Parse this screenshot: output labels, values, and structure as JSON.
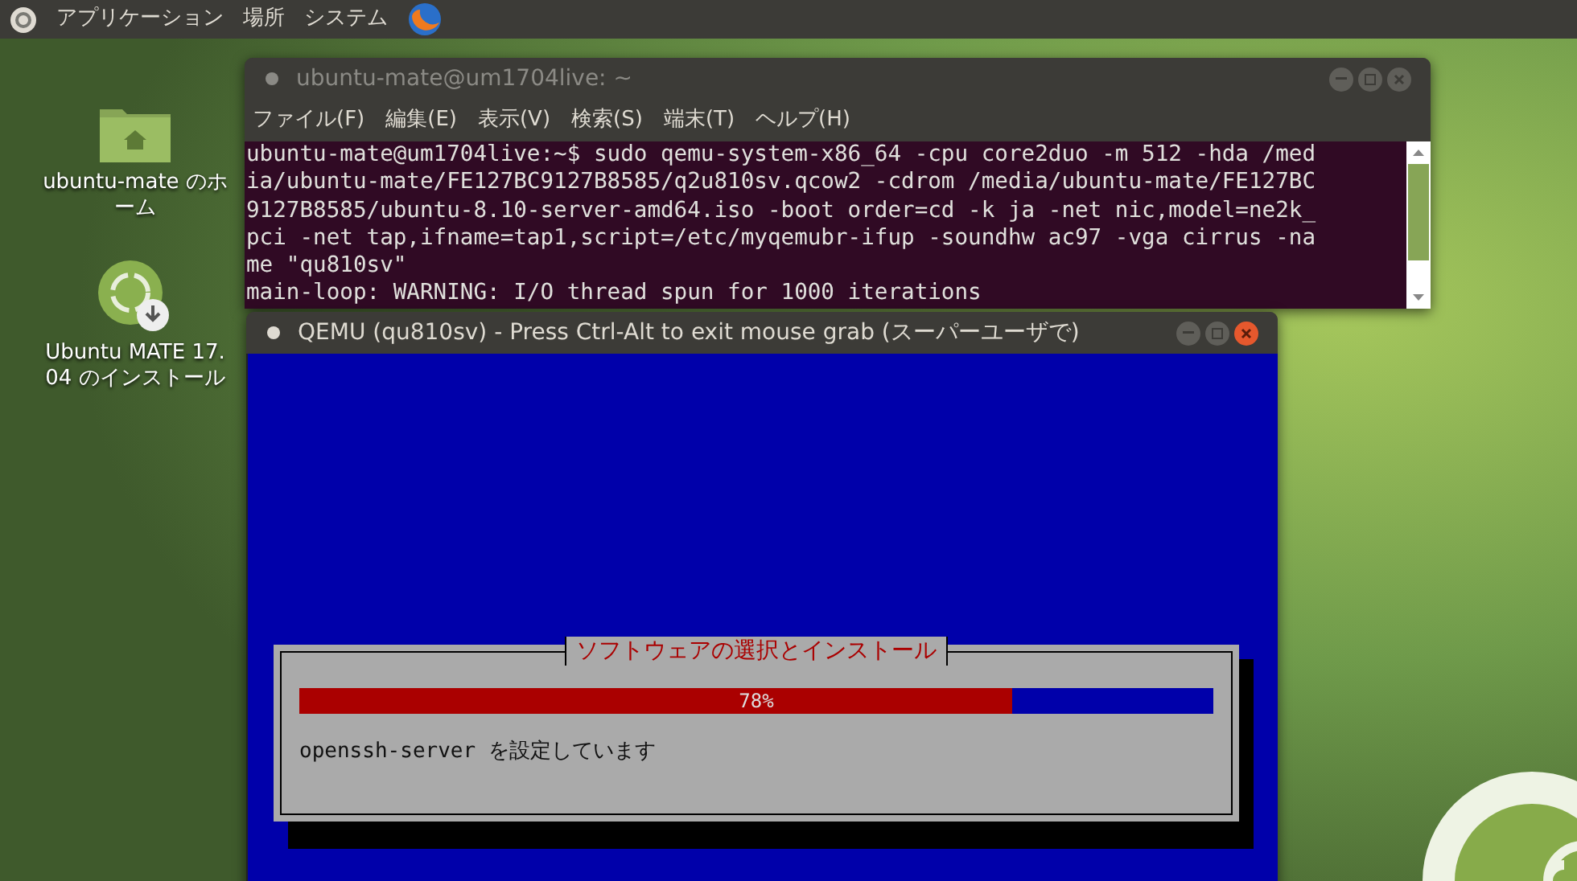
{
  "top_panel": {
    "menus": [
      "アプリケーション",
      "場所",
      "システム"
    ]
  },
  "desktop_icons": [
    {
      "kind": "home-folder",
      "label_lines": [
        "ubuntu-mate のホ",
        "ーム"
      ]
    },
    {
      "kind": "installer",
      "label_lines": [
        "Ubuntu MATE 17.",
        "04 のインストール"
      ]
    }
  ],
  "terminal": {
    "title": "ubuntu-mate@um1704live: ~",
    "active": false,
    "menu": [
      "ファイル(F)",
      "編集(E)",
      "表示(V)",
      "検索(S)",
      "端末(T)",
      "ヘルプ(H)"
    ],
    "lines": [
      "ubuntu-mate@um1704live:~$ sudo qemu-system-x86_64 -cpu core2duo -m 512 -hda /med",
      "ia/ubuntu-mate/FE127BC9127B8585/q2u810sv.qcow2 -cdrom /media/ubuntu-mate/FE127BC",
      "9127B8585/ubuntu-8.10-server-amd64.iso -boot order=cd -k ja -net nic,model=ne2k_",
      "pci -net tap,ifname=tap1,script=/etc/myqemubr-ifup -soundhw ac97 -vga cirrus -na",
      "me \"qu810sv\"",
      "main-loop: WARNING: I/O thread spun for 1000 iterations"
    ]
  },
  "qemu": {
    "title": "QEMU (qu810sv) - Press Ctrl-Alt to exit mouse grab (スーパーユーザで)",
    "active": true,
    "dialog": {
      "title": "ソフトウェアの選択とインストール",
      "progress": {
        "level": 0.78,
        "text": "78%"
      },
      "status": "openssh-server を設定しています"
    }
  }
}
